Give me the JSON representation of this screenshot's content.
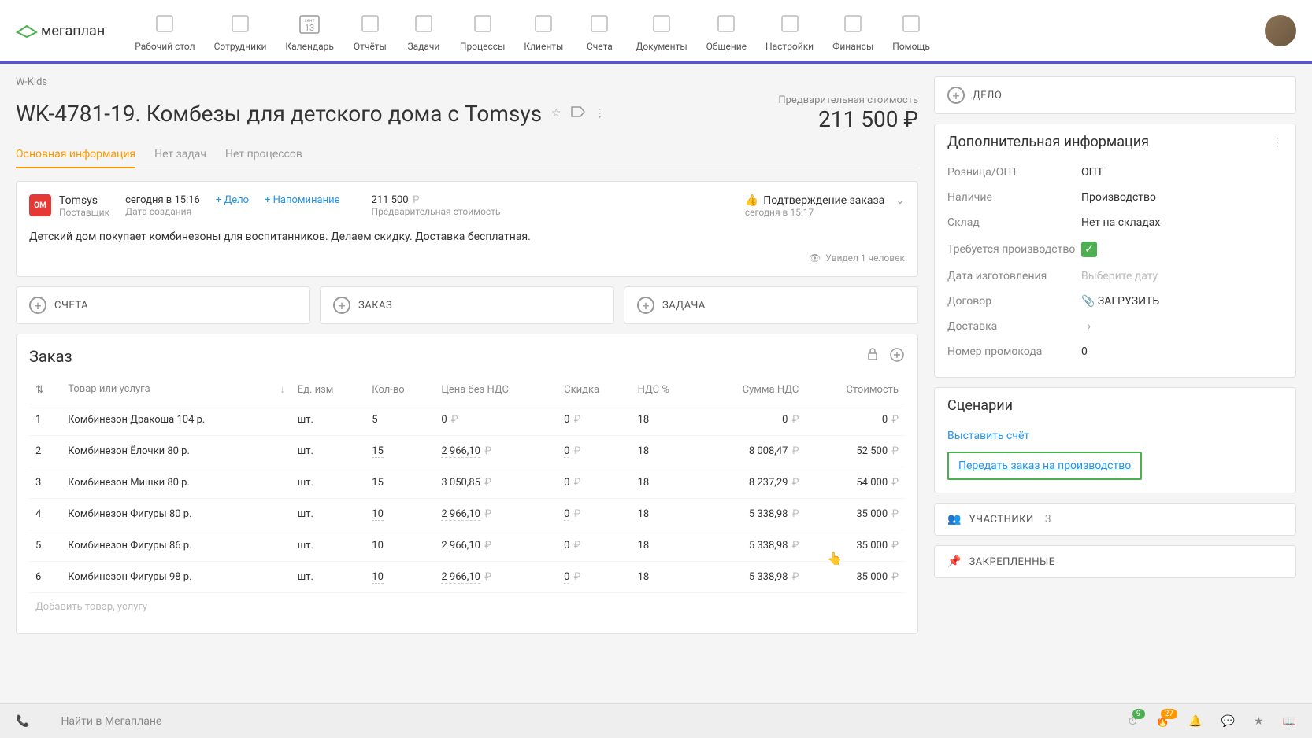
{
  "logo": "мегаплан",
  "nav": [
    {
      "label": "Рабочий стол",
      "icon": "desktop"
    },
    {
      "label": "Сотрудники",
      "icon": "staff"
    },
    {
      "label": "Календарь",
      "icon": "calendar",
      "day": "13",
      "month": "сент"
    },
    {
      "label": "Отчёты",
      "icon": "reports"
    },
    {
      "label": "Задачи",
      "icon": "tasks"
    },
    {
      "label": "Процессы",
      "icon": "processes"
    },
    {
      "label": "Клиенты",
      "icon": "clients"
    },
    {
      "label": "Счета",
      "icon": "invoices"
    },
    {
      "label": "Документы",
      "icon": "docs"
    },
    {
      "label": "Общение",
      "icon": "chat"
    },
    {
      "label": "Настройки",
      "icon": "settings"
    },
    {
      "label": "Финансы",
      "icon": "finance"
    },
    {
      "label": "Помощь",
      "icon": "help"
    }
  ],
  "breadcrumb": "W-Kids",
  "title": "WK-4781-19. Комбезы для детского дома с Tomsys",
  "cost_label": "Предварительная стоимость",
  "cost_value": "211 500 ₽",
  "tabs": [
    "Основная информация",
    "Нет задач",
    "Нет процессов"
  ],
  "supplier": {
    "name": "Tomsys",
    "role": "Поставщик",
    "icon": "OM"
  },
  "created": {
    "value": "сегодня в 15:16",
    "label": "Дата создания"
  },
  "links": {
    "deal": "+ Дело",
    "reminder": "+ Напоминание"
  },
  "amount": {
    "value": "211 500",
    "label": "Предварительная стоимость"
  },
  "status": {
    "text": "Подтверждение заказа",
    "time": "сегодня в 15:17"
  },
  "description": "Детский дом покупает комбинезоны для воспитанников. Делаем скидку. Доставка бесплатная.",
  "viewed": "Увидел 1 человек",
  "actions": [
    "СЧЕТА",
    "ЗАКАЗ",
    "ЗАДАЧА"
  ],
  "order": {
    "title": "Заказ",
    "columns": [
      "",
      "Товар или услуга",
      "Ед. изм",
      "Кол-во",
      "Цена без НДС",
      "Скидка",
      "НДС %",
      "Сумма НДС",
      "Стоимость"
    ],
    "rows": [
      {
        "n": "1",
        "name": "Комбинезон Дракоша 104 р.",
        "unit": "шт.",
        "qty": "5",
        "price": "0",
        "discount": "0",
        "vat": "18",
        "vat_sum": "0",
        "total": "0"
      },
      {
        "n": "2",
        "name": "Комбинезон Ёлочки 80 р.",
        "unit": "шт.",
        "qty": "15",
        "price": "2 966,10",
        "discount": "0",
        "vat": "18",
        "vat_sum": "8 008,47",
        "total": "52 500"
      },
      {
        "n": "3",
        "name": "Комбинезон Мишки 80 р.",
        "unit": "шт.",
        "qty": "15",
        "price": "3 050,85",
        "discount": "0",
        "vat": "18",
        "vat_sum": "8 237,29",
        "total": "54 000"
      },
      {
        "n": "4",
        "name": "Комбинезон Фигуры 80 р.",
        "unit": "шт.",
        "qty": "10",
        "price": "2 966,10",
        "discount": "0",
        "vat": "18",
        "vat_sum": "5 338,98",
        "total": "35 000"
      },
      {
        "n": "5",
        "name": "Комбинезон Фигуры 86 р.",
        "unit": "шт.",
        "qty": "10",
        "price": "2 966,10",
        "discount": "0",
        "vat": "18",
        "vat_sum": "5 338,98",
        "total": "35 000"
      },
      {
        "n": "6",
        "name": "Комбинезон Фигуры 98 р.",
        "unit": "шт.",
        "qty": "10",
        "price": "2 966,10",
        "discount": "0",
        "vat": "18",
        "vat_sum": "5 338,98",
        "total": "35 000"
      }
    ],
    "add": "Добавить товар, услугу"
  },
  "side": {
    "deal": "ДЕЛО",
    "info_title": "Дополнительная информация",
    "fields": [
      {
        "label": "Розница/ОПТ",
        "value": "ОПТ"
      },
      {
        "label": "Наличие",
        "value": "Производство"
      },
      {
        "label": "Склад",
        "value": "Нет на складах"
      },
      {
        "label": "Требуется производство",
        "value": "check"
      },
      {
        "label": "Дата изготовления",
        "value": "Выберите дату",
        "placeholder": true
      },
      {
        "label": "Договор",
        "value": "ЗАГРУЗИТЬ",
        "upload": true
      },
      {
        "label": "Доставка",
        "value": "",
        "chevron": true
      },
      {
        "label": "Номер промокода",
        "value": "0"
      }
    ],
    "scenarios_title": "Сценарии",
    "scenarios": [
      "Выставить счёт",
      "Передать заказ на производство"
    ],
    "participants": "УЧАСТНИКИ",
    "participants_count": "3",
    "pinned": "ЗАКРЕПЛЕННЫЕ"
  },
  "bottom": {
    "search": "Найти в Мегаплане",
    "badge1": "9",
    "badge2": "27"
  }
}
